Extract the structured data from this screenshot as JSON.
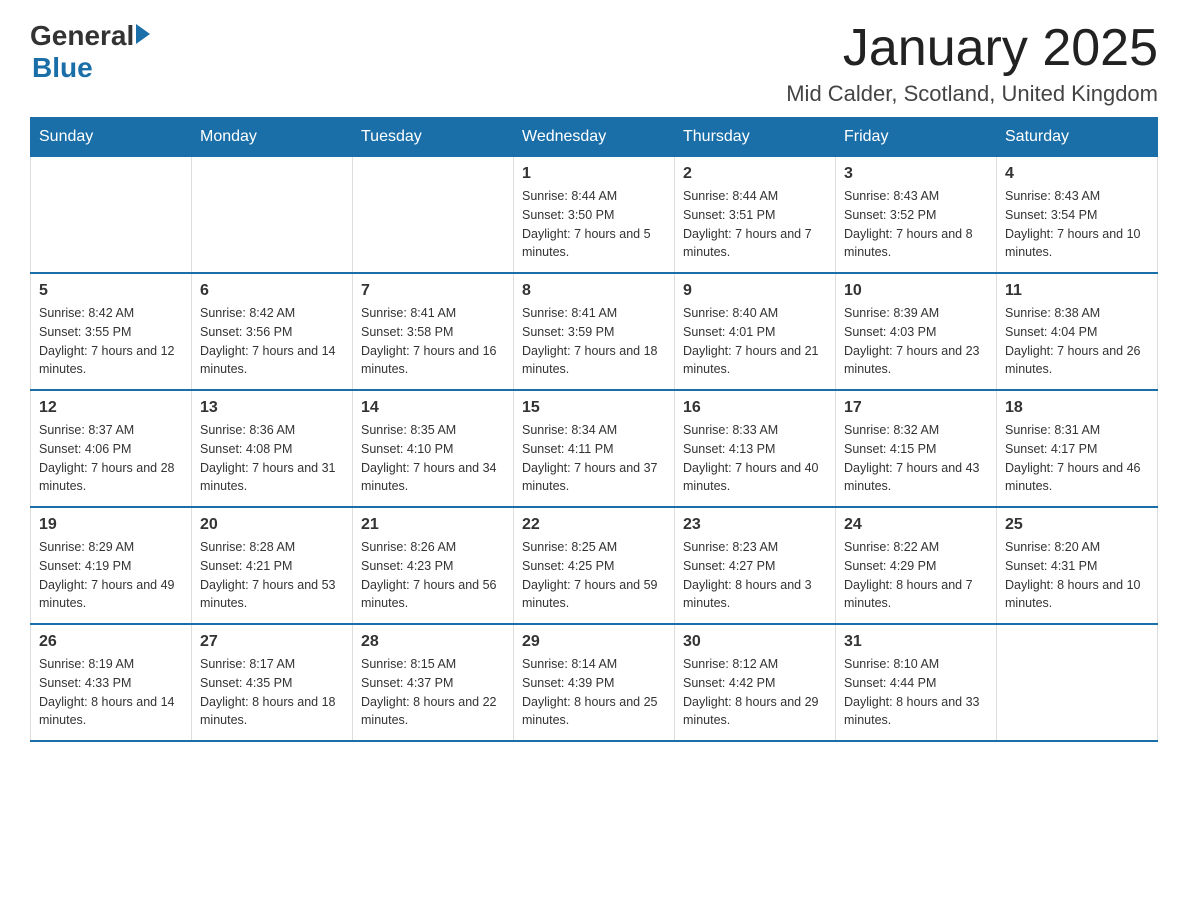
{
  "logo": {
    "general": "General",
    "blue": "Blue"
  },
  "title": "January 2025",
  "subtitle": "Mid Calder, Scotland, United Kingdom",
  "days_of_week": [
    "Sunday",
    "Monday",
    "Tuesday",
    "Wednesday",
    "Thursday",
    "Friday",
    "Saturday"
  ],
  "weeks": [
    [
      {
        "day": "",
        "info": ""
      },
      {
        "day": "",
        "info": ""
      },
      {
        "day": "",
        "info": ""
      },
      {
        "day": "1",
        "info": "Sunrise: 8:44 AM\nSunset: 3:50 PM\nDaylight: 7 hours and 5 minutes."
      },
      {
        "day": "2",
        "info": "Sunrise: 8:44 AM\nSunset: 3:51 PM\nDaylight: 7 hours and 7 minutes."
      },
      {
        "day": "3",
        "info": "Sunrise: 8:43 AM\nSunset: 3:52 PM\nDaylight: 7 hours and 8 minutes."
      },
      {
        "day": "4",
        "info": "Sunrise: 8:43 AM\nSunset: 3:54 PM\nDaylight: 7 hours and 10 minutes."
      }
    ],
    [
      {
        "day": "5",
        "info": "Sunrise: 8:42 AM\nSunset: 3:55 PM\nDaylight: 7 hours and 12 minutes."
      },
      {
        "day": "6",
        "info": "Sunrise: 8:42 AM\nSunset: 3:56 PM\nDaylight: 7 hours and 14 minutes."
      },
      {
        "day": "7",
        "info": "Sunrise: 8:41 AM\nSunset: 3:58 PM\nDaylight: 7 hours and 16 minutes."
      },
      {
        "day": "8",
        "info": "Sunrise: 8:41 AM\nSunset: 3:59 PM\nDaylight: 7 hours and 18 minutes."
      },
      {
        "day": "9",
        "info": "Sunrise: 8:40 AM\nSunset: 4:01 PM\nDaylight: 7 hours and 21 minutes."
      },
      {
        "day": "10",
        "info": "Sunrise: 8:39 AM\nSunset: 4:03 PM\nDaylight: 7 hours and 23 minutes."
      },
      {
        "day": "11",
        "info": "Sunrise: 8:38 AM\nSunset: 4:04 PM\nDaylight: 7 hours and 26 minutes."
      }
    ],
    [
      {
        "day": "12",
        "info": "Sunrise: 8:37 AM\nSunset: 4:06 PM\nDaylight: 7 hours and 28 minutes."
      },
      {
        "day": "13",
        "info": "Sunrise: 8:36 AM\nSunset: 4:08 PM\nDaylight: 7 hours and 31 minutes."
      },
      {
        "day": "14",
        "info": "Sunrise: 8:35 AM\nSunset: 4:10 PM\nDaylight: 7 hours and 34 minutes."
      },
      {
        "day": "15",
        "info": "Sunrise: 8:34 AM\nSunset: 4:11 PM\nDaylight: 7 hours and 37 minutes."
      },
      {
        "day": "16",
        "info": "Sunrise: 8:33 AM\nSunset: 4:13 PM\nDaylight: 7 hours and 40 minutes."
      },
      {
        "day": "17",
        "info": "Sunrise: 8:32 AM\nSunset: 4:15 PM\nDaylight: 7 hours and 43 minutes."
      },
      {
        "day": "18",
        "info": "Sunrise: 8:31 AM\nSunset: 4:17 PM\nDaylight: 7 hours and 46 minutes."
      }
    ],
    [
      {
        "day": "19",
        "info": "Sunrise: 8:29 AM\nSunset: 4:19 PM\nDaylight: 7 hours and 49 minutes."
      },
      {
        "day": "20",
        "info": "Sunrise: 8:28 AM\nSunset: 4:21 PM\nDaylight: 7 hours and 53 minutes."
      },
      {
        "day": "21",
        "info": "Sunrise: 8:26 AM\nSunset: 4:23 PM\nDaylight: 7 hours and 56 minutes."
      },
      {
        "day": "22",
        "info": "Sunrise: 8:25 AM\nSunset: 4:25 PM\nDaylight: 7 hours and 59 minutes."
      },
      {
        "day": "23",
        "info": "Sunrise: 8:23 AM\nSunset: 4:27 PM\nDaylight: 8 hours and 3 minutes."
      },
      {
        "day": "24",
        "info": "Sunrise: 8:22 AM\nSunset: 4:29 PM\nDaylight: 8 hours and 7 minutes."
      },
      {
        "day": "25",
        "info": "Sunrise: 8:20 AM\nSunset: 4:31 PM\nDaylight: 8 hours and 10 minutes."
      }
    ],
    [
      {
        "day": "26",
        "info": "Sunrise: 8:19 AM\nSunset: 4:33 PM\nDaylight: 8 hours and 14 minutes."
      },
      {
        "day": "27",
        "info": "Sunrise: 8:17 AM\nSunset: 4:35 PM\nDaylight: 8 hours and 18 minutes."
      },
      {
        "day": "28",
        "info": "Sunrise: 8:15 AM\nSunset: 4:37 PM\nDaylight: 8 hours and 22 minutes."
      },
      {
        "day": "29",
        "info": "Sunrise: 8:14 AM\nSunset: 4:39 PM\nDaylight: 8 hours and 25 minutes."
      },
      {
        "day": "30",
        "info": "Sunrise: 8:12 AM\nSunset: 4:42 PM\nDaylight: 8 hours and 29 minutes."
      },
      {
        "day": "31",
        "info": "Sunrise: 8:10 AM\nSunset: 4:44 PM\nDaylight: 8 hours and 33 minutes."
      },
      {
        "day": "",
        "info": ""
      }
    ]
  ]
}
